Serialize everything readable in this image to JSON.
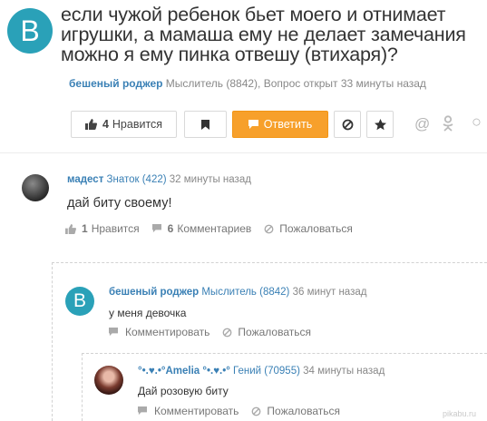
{
  "question": {
    "avatar_letter": "B",
    "title": "если чужой ребенок бьет моего и отнимает игрушки, а мамаша ему не делает замечания можно я ему пинка отвешу (втихаря)?",
    "author": "бешеный роджер",
    "author_rank": "Мыслитель (8842),",
    "status": "Вопрос открыт 33 минуты назад"
  },
  "toolbar": {
    "like_count": "4",
    "like_label": "Нравится",
    "answer_label": "Ответить"
  },
  "answer": {
    "author": "мадест",
    "author_rank": "Знаток (422)",
    "time": "32 минуты назад",
    "text": "дай биту своему!",
    "likes_count": "1",
    "likes_label": "Нравится",
    "comments_count": "6",
    "comments_label": "Комментариев",
    "report_label": "Пожаловаться"
  },
  "comments": [
    {
      "avatar_letter": "B",
      "author": "бешеный роджер",
      "author_rank": "Мыслитель (8842)",
      "time": "36 минут назад",
      "text": "у меня девочка",
      "comment_label": "Комментировать",
      "report_label": "Пожаловаться"
    },
    {
      "author": "°•.♥.•°Amelia °•.♥.•°",
      "author_rank": "Гений (70955)",
      "time": "34 минуты назад",
      "text": "Дай розовую биту",
      "comment_label": "Комментировать",
      "report_label": "Пожаловаться"
    }
  ],
  "watermark": "pikabu.ru",
  "colors": {
    "accent": "#f7a02b",
    "link": "#3a80b5",
    "avatar": "#2aa1b8"
  }
}
